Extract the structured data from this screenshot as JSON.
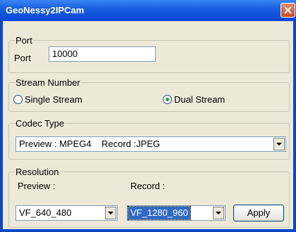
{
  "window": {
    "title": "GeoNessy2IPCam"
  },
  "port": {
    "group_label": "Port",
    "field_label": "Port",
    "value": "10000"
  },
  "stream": {
    "group_label": "Stream Number",
    "options": [
      {
        "label": "Single Stream",
        "selected": false
      },
      {
        "label": "Dual Stream",
        "selected": true
      }
    ]
  },
  "codec": {
    "group_label": "Codec Type",
    "selected": "Preview : MPEG4    Record :JPEG"
  },
  "resolution": {
    "group_label": "Resolution",
    "preview_label": "Preview :",
    "preview_value": "VF_640_480",
    "record_label": "Record :",
    "record_value": "VF_1280_960",
    "apply_label": "Apply"
  },
  "icons": {
    "close": "close-icon",
    "dropdown": "chevron-down-icon"
  },
  "colors": {
    "titlebar": "#0846d6",
    "close": "#d04a22",
    "panel": "#ece9d8",
    "selection": "#316ac5"
  }
}
